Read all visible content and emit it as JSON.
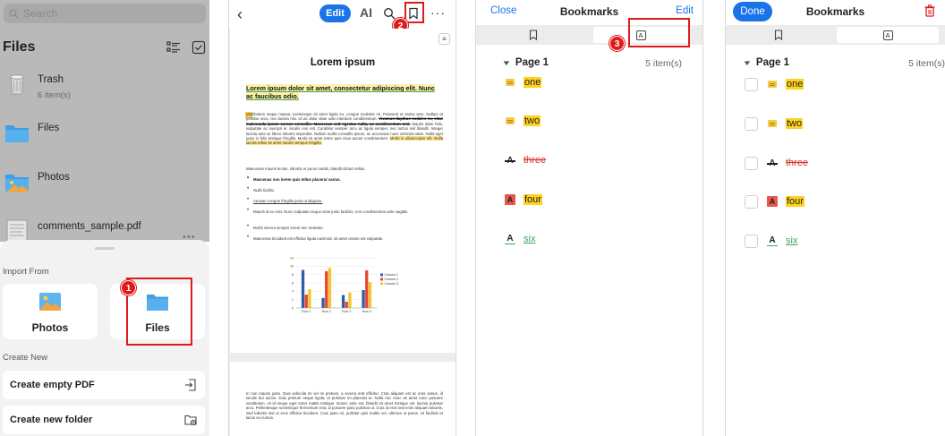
{
  "panel1": {
    "search_placeholder": "Search",
    "title": "Files",
    "rows": [
      {
        "name": "Trash",
        "sub": "6 item(s)"
      },
      {
        "name": "Files",
        "sub": ""
      },
      {
        "name": "Photos",
        "sub": ""
      },
      {
        "name": "comments_sample.pdf",
        "sub": ""
      }
    ],
    "more": "•••",
    "import_label": "Import From",
    "import_options": [
      {
        "label": "Photos"
      },
      {
        "label": "Files"
      }
    ],
    "create_label": "Create New",
    "create_options": [
      {
        "label": "Create empty PDF"
      },
      {
        "label": "Create new folder"
      }
    ],
    "step_badge": "1"
  },
  "panel2": {
    "back": "‹",
    "edit_label": "Edit",
    "ai_label": "AI",
    "more": "···",
    "step_badge": "2",
    "side_toggle": "≡",
    "doc": {
      "title": "Lorem ipsum",
      "subtitle": "Lorem ipsum dolor sit amet, consectetur adipiscing elit. Nunc ac faucibus odio.",
      "para_a": "Vestibulum neque massa, scelerisque sit amet ligula eu, congue molestie mi. Praesent ut varius sem. Nullam at porttitor arcu, nec lacinia nisi. Ut ac dolor vitae odio interdum condimentum.",
      "para_struck": "Vivamus dapibus sodales ex, vitae malesuada ipsum cursus convallis. Maecenas sed egestas nulla, ac condimentum orci.",
      "para_b": "Mauris diam felis, vulputate ac suscipit et, iaculis non est. Curabitur semper arcu ac ligula semper, nec luctus nisl blandit. Integer lacinia ante ac libero lobortis imperdiet. Nullam mollis convallis ipsum, ac accumsan nunc vehicula vitae. Nulla eget justo in felis tristique fringilla. Morbi sit amet tortor quis risus auctor condimentum.",
      "para_hl": "Morbi in ullamcorper elit. Nulla iaculis tellus sit amet mauris tempus fringilla.",
      "para_c": "Maecenas mauris lectus, lobortis et purus mattis, blandit dictum tellus.",
      "bullets": [
        "Maecenas non lorem quis tellus placerat varius.",
        "Nulla facilisi.",
        "Aenean congue fringilla justo ut aliquam.",
        "Mauris id ex erat. Nunc vulputate neque vitae justo facilisis, non condimentum ante sagittis.",
        "Morbi viverra semper lorem nec molestie.",
        "Maecenas tincidunt est efficitur ligula euismod, sit amet ornare est vulputate."
      ],
      "page2_text": "In non mauris justo. Duis vehicula mi vel mi pretium, a viverra erat efficitur. Cras aliquam est ac eros varius, id iaculis dui auctor. Duis pretium neque ligula, et pulvinar mi placerat et. Nulla nec nunc sit amet nunc posuere vestibulum. Ut id neque eget tortor mattis tristique. Donec ante est, blandit sit amet tristique vel, lacinia pulvinar arcu. Pellentesque scelerisque fermentum erat, id posuere justo pulvinar ut. Cras id eros sed enim aliquam lobortis. Sed lobortis nisl ut eros efficitur tincidunt. Cras justo mi, porttitor quis mattis vel, ultricies ut purus. Ut facilisis et lacus eu cursus."
    },
    "chart_data": {
      "type": "bar",
      "categories": [
        "Row 1",
        "Row 2",
        "Row 3",
        "Row 4"
      ],
      "series": [
        {
          "name": "Column 1",
          "values": [
            9.1,
            2.4,
            3.1,
            4.3
          ],
          "color": "#2f5ea8"
        },
        {
          "name": "Column 2",
          "values": [
            3.2,
            8.8,
            1.5,
            9.0
          ],
          "color": "#e8452c"
        },
        {
          "name": "Column 3",
          "values": [
            4.5,
            9.6,
            3.7,
            6.2
          ],
          "color": "#f4c430"
        }
      ],
      "yticks": [
        "0",
        "2",
        "4",
        "6",
        "8",
        "10",
        "12"
      ],
      "ylim": [
        0,
        12
      ],
      "legend": "right"
    }
  },
  "panel3": {
    "left": "Close",
    "title": "Bookmarks",
    "right": "Edit",
    "step_badge": "3"
  },
  "panel4": {
    "left": "Done",
    "title": "Bookmarks"
  },
  "bookmarks": {
    "seg_annot_letter": "A",
    "page_label": "Page 1",
    "count": "5 item(s)",
    "items": [
      {
        "kind": "note",
        "text": "one",
        "style": "hl"
      },
      {
        "kind": "note",
        "text": "two",
        "style": "hl"
      },
      {
        "kind": "strike",
        "icon": "A",
        "text": "three",
        "style": "st"
      },
      {
        "kind": "box",
        "icon": "A",
        "text": "four",
        "style": "hl"
      },
      {
        "kind": "under",
        "icon": "A",
        "text": "six",
        "style": "ul"
      }
    ]
  },
  "colors": {
    "accent": "#1a73e8",
    "callout": "#e0191b",
    "highlight": "#ffd21f"
  }
}
